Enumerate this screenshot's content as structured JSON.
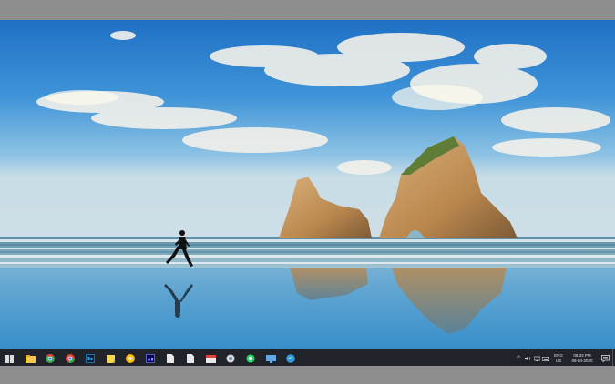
{
  "taskbar": {
    "start_icon": "windows-logo-icon",
    "apps": [
      {
        "name": "file-explorer-icon",
        "color": "#f2c94c",
        "active": false
      },
      {
        "name": "chrome-icon",
        "color": "#34a853",
        "active": true
      },
      {
        "name": "chrome-icon-2",
        "color": "#ea4335",
        "active": true
      },
      {
        "name": "photoshop-icon",
        "color": "#31a8ff",
        "active": true
      },
      {
        "name": "sticky-notes-icon",
        "color": "#f6d64a",
        "active": false
      },
      {
        "name": "chrome-canary-icon",
        "color": "#fbbc05",
        "active": true
      },
      {
        "name": "after-effects-icon",
        "color": "#9999ff",
        "active": true
      },
      {
        "name": "document-icon",
        "color": "#e8e8e8",
        "active": false
      },
      {
        "name": "document-icon-2",
        "color": "#e8e8e8",
        "active": false
      },
      {
        "name": "calendar-app-icon",
        "color": "#e0443a",
        "active": false
      },
      {
        "name": "snipping-tool-icon",
        "color": "#d9d9d9",
        "active": false
      },
      {
        "name": "whatsapp-icon",
        "color": "#25d366",
        "active": false
      },
      {
        "name": "screen-capture-icon",
        "color": "#62a8e5",
        "active": false
      },
      {
        "name": "edge-icon",
        "color": "#2f9be6",
        "active": false
      }
    ],
    "tray": {
      "chevron": "^",
      "lang_top": "ENG",
      "lang_bottom": "US",
      "time": "05:33 PM",
      "date": "06-04-2020"
    }
  },
  "colors": {
    "taskbar_bg": "#20242a",
    "sky_top": "#1a73c9",
    "sea": "#6fb2d6",
    "frame": "#8e8e8e"
  }
}
